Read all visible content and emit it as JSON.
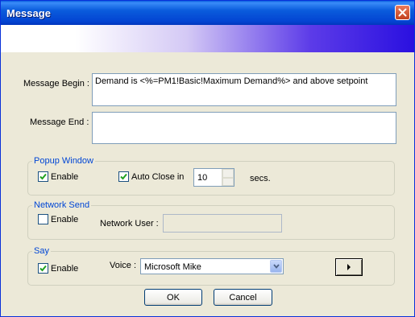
{
  "window": {
    "title": "Message"
  },
  "message": {
    "begin_label": "Message Begin :",
    "begin_value": "Demand is <%=PM1!Basic!Maximum Demand%>  and above setpoint",
    "end_label": "Message End :",
    "end_value": ""
  },
  "popup": {
    "title": "Popup Window",
    "enable_label": "Enable",
    "enable_checked": true,
    "autoclose_label": "Auto Close in",
    "autoclose_checked": true,
    "seconds_value": "10",
    "seconds_unit": "secs."
  },
  "network": {
    "title": "Network Send",
    "enable_label": "Enable",
    "enable_checked": false,
    "user_label": "Network User :",
    "user_value": ""
  },
  "say": {
    "title": "Say",
    "enable_label": "Enable",
    "enable_checked": true,
    "voice_label": "Voice :",
    "voice_value": "Microsoft Mike"
  },
  "buttons": {
    "ok": "OK",
    "cancel": "Cancel"
  },
  "colors": {
    "titlebar": "#0a5cdc",
    "group_title": "#0046d5",
    "dialog_bg": "#ece9d8"
  },
  "icons": {
    "close": "close-icon",
    "check": "check-icon",
    "play": "play-icon",
    "dropdown": "chevron-down-icon"
  }
}
